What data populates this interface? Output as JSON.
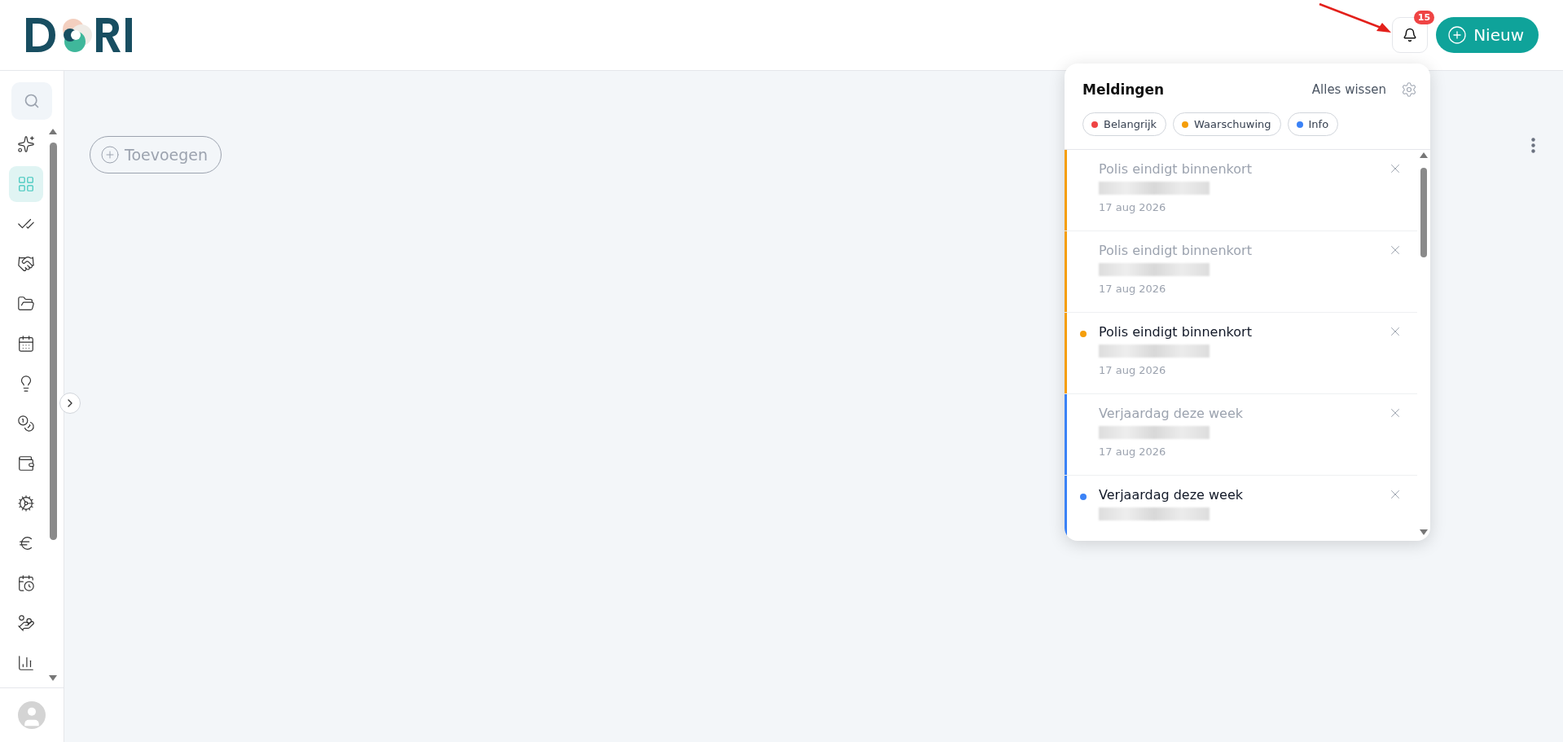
{
  "header": {
    "notification_count": "15",
    "new_button": "Nieuw"
  },
  "sidebar": {
    "items": [
      {
        "kind": "sparkle",
        "selected": false
      },
      {
        "kind": "grid",
        "selected": true
      },
      {
        "kind": "checks",
        "selected": false
      },
      {
        "kind": "handshake",
        "selected": false
      },
      {
        "kind": "folder",
        "selected": false
      },
      {
        "kind": "calendar",
        "selected": false
      },
      {
        "kind": "bulb",
        "selected": false
      },
      {
        "kind": "coins",
        "selected": false
      },
      {
        "kind": "wallet",
        "selected": false
      },
      {
        "kind": "cog",
        "selected": false
      },
      {
        "kind": "euro",
        "selected": false
      },
      {
        "kind": "schedule",
        "selected": false
      },
      {
        "kind": "handcoins",
        "selected": false
      },
      {
        "kind": "chart",
        "selected": false
      }
    ]
  },
  "content": {
    "add_button": "Toevoegen"
  },
  "notifications": {
    "title": "Meldingen",
    "clear_all": "Alles wissen",
    "filters": [
      {
        "label": "Belangrijk",
        "color": "#ef4444"
      },
      {
        "label": "Waarschuwing",
        "color": "#f59e0b"
      },
      {
        "label": "Info",
        "color": "#3b82f6"
      }
    ],
    "items": [
      {
        "title": "Polis eindigt binnenkort",
        "date": "17 aug 2026",
        "unread": false,
        "color": "#f59e0b"
      },
      {
        "title": "Polis eindigt binnenkort",
        "date": "17 aug 2026",
        "unread": false,
        "color": "#f59e0b"
      },
      {
        "title": "Polis eindigt binnenkort",
        "date": "17 aug 2026",
        "unread": true,
        "color": "#f59e0b"
      },
      {
        "title": "Verjaardag deze week",
        "date": "17 aug 2026",
        "unread": false,
        "color": "#3b82f6"
      },
      {
        "title": "Verjaardag deze week",
        "unread": true,
        "color": "#3b82f6"
      }
    ]
  }
}
